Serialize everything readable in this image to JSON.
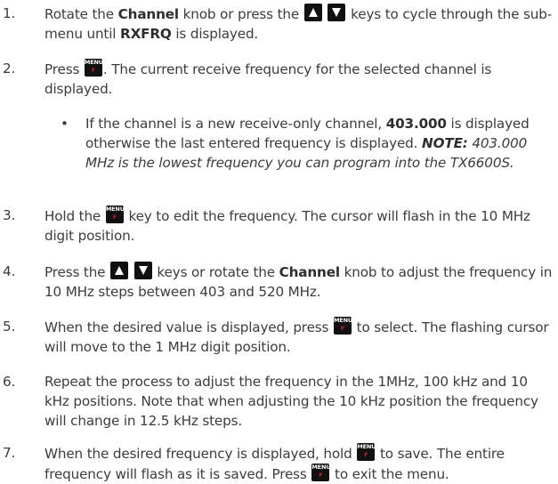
{
  "keys": {
    "menu_top": "MENU",
    "menu_bottom": "F"
  },
  "steps": [
    {
      "num": "1.",
      "t1": "Rotate the ",
      "b1": "Channel",
      "t2": " knob or press the ",
      "t3": " keys to cycle through the sub-menu until ",
      "b2": "RXFRQ",
      "t4": " is displayed."
    },
    {
      "num": "2.",
      "t1": "Press ",
      "t2": ". The current receive frequency for the selected channel is displayed."
    },
    {
      "bullet": "•",
      "t1": "If the channel is a new receive-only channel, ",
      "b1": "403.000",
      "t2": " is displayed otherwise the last entered frequency is displayed. ",
      "note_label": "NOTE:",
      "note_text": " 403.000 MHz is the lowest frequency you can program into the TX6600S."
    },
    {
      "num": "3.",
      "t1": "Hold the ",
      "t2": " key to edit the frequency. The cursor will flash in the 10 MHz digit position."
    },
    {
      "num": "4.",
      "t1": "Press the ",
      "t2": " keys or rotate the ",
      "b1": "Channel",
      "t3": " knob to adjust the frequency in 10 MHz steps between 403 and 520 MHz."
    },
    {
      "num": "5.",
      "t1": "When the desired value is displayed, press ",
      "t2": " to select.  The flashing cursor will move to the 1 MHz digit position."
    },
    {
      "num": "6.",
      "t1": "Repeat the process to adjust the frequency in the 1MHz, 100 kHz and 10 kHz positions. Note that when adjusting the 10 kHz position the frequency will change in 12.5 kHz steps."
    },
    {
      "num": "7.",
      "t1": "When the desired frequency is displayed, hold ",
      "t2": " to save. The entire frequency will flash as it is saved. Press ",
      "t3": " to exit the menu."
    }
  ]
}
